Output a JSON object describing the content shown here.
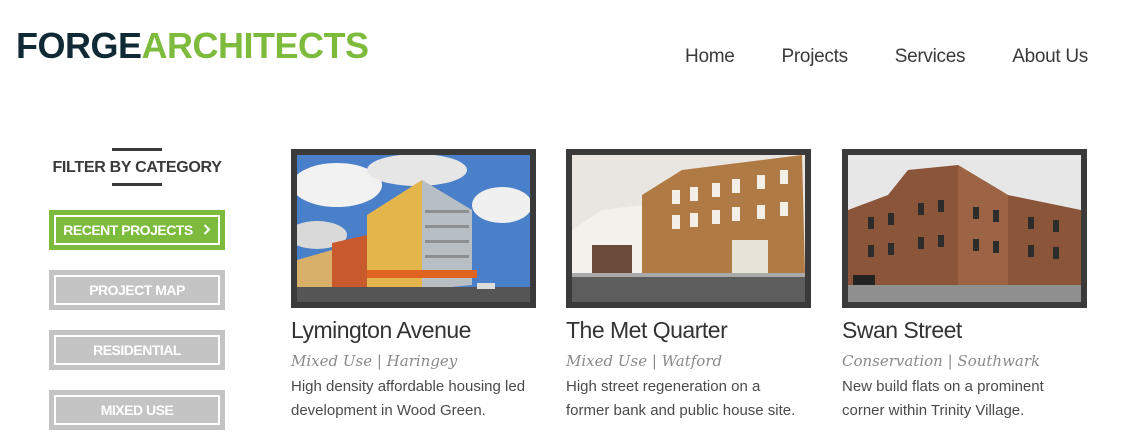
{
  "logo": {
    "part1": "FORGE",
    "part2": "ARCHITECTS"
  },
  "nav": {
    "items": [
      "Home",
      "Projects",
      "Services",
      "About Us"
    ]
  },
  "filter": {
    "title": "FILTER BY CATEGORY",
    "buttons": [
      "RECENT PROJECTS",
      "PROJECT MAP",
      "RESIDENTIAL",
      "MIXED USE"
    ]
  },
  "projects": [
    {
      "title": "Lymington Avenue",
      "meta": "Mixed Use | Haringey",
      "desc1": "High density affordable housing led",
      "desc2": "development in Wood Green."
    },
    {
      "title": "The Met Quarter",
      "meta": "Mixed Use | Watford",
      "desc1": "High street regeneration on a",
      "desc2": "former bank and public house site."
    },
    {
      "title": "Swan Street",
      "meta": "Conservation | Southwark",
      "desc1": "New build flats on a prominent",
      "desc2": "corner within Trinity Village."
    }
  ],
  "colors": {
    "brand_dark": "#0f2a35",
    "brand_green": "#7cbb3c",
    "button_grey": "#c4c4c4",
    "frame": "#3a3a3a"
  },
  "icons": {
    "chevron": "chevron-right-icon"
  }
}
